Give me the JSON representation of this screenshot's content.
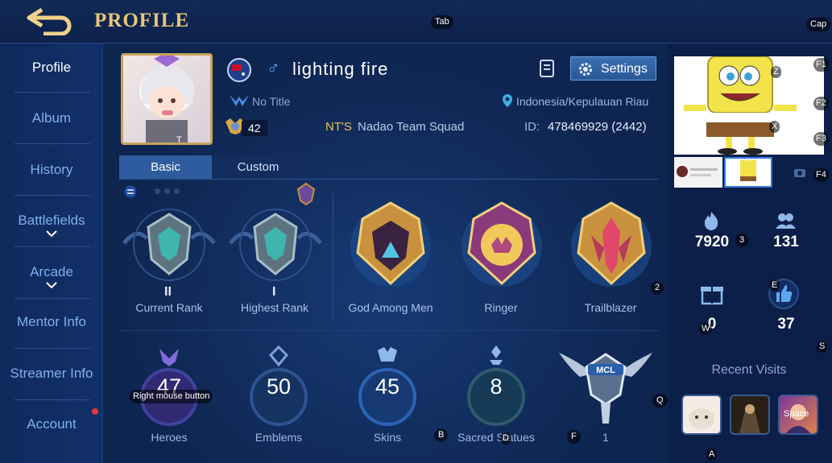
{
  "header": {
    "title": "PROFILE"
  },
  "keys": {
    "tab": "Tab",
    "cap": "Cap",
    "f1": "F1",
    "f2": "F2",
    "f3": "F3",
    "f4": "F4",
    "t": "T",
    "z": "Z",
    "x": "X",
    "k2": "2",
    "k3": "3",
    "e": "E",
    "w": "W",
    "s": "S",
    "q": "Q",
    "b": "B",
    "d": "D",
    "f": "F",
    "a": "A",
    "space": "Space",
    "rmb": "Right mouse button"
  },
  "sidebar": {
    "items": [
      "Profile",
      "Album",
      "History",
      "Battlefields",
      "Arcade",
      "Mentor Info",
      "Streamer Info",
      "Account"
    ]
  },
  "player": {
    "name": "lighting fire",
    "gender_symbol": "♂",
    "title": "No Title",
    "level": "42",
    "squad_tag": "NT'S",
    "squad_name": "Nadao Team Squad",
    "location": "Indonesia/Kepulauan Riau",
    "id_label": "ID:",
    "id_value": "478469929 (2442)"
  },
  "settings_label": "Settings",
  "tabs": [
    "Basic",
    "Custom"
  ],
  "ranks": [
    {
      "caption": "Current Rank",
      "tier": "II"
    },
    {
      "caption": "Highest Rank",
      "tier": "I"
    }
  ],
  "achievements": [
    "God Among Men",
    "Ringer",
    "Trailblazer"
  ],
  "stats": [
    {
      "caption": "Heroes",
      "value": "47"
    },
    {
      "caption": "Emblems",
      "value": "50"
    },
    {
      "caption": "Skins",
      "value": "45"
    },
    {
      "caption": "Sacred Statues",
      "value": "8"
    }
  ],
  "mcl": {
    "badge_text": "MCL",
    "count": "1"
  },
  "right_stats": {
    "popularity": "7920",
    "followers": "131",
    "gifts": "0",
    "likes": "37"
  },
  "recent_visits_label": "Recent Visits",
  "colors": {
    "gold": "#e8c678",
    "accent_blue": "#7fb0ee"
  }
}
